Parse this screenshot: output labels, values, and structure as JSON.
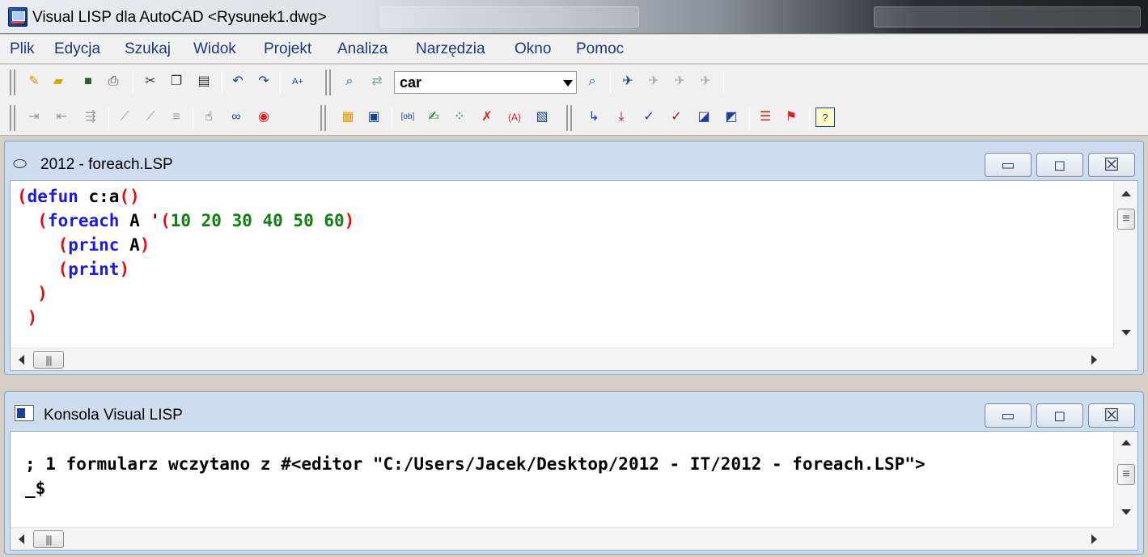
{
  "window": {
    "title": "Visual LISP dla AutoCAD <Rysunek1.dwg>"
  },
  "menu": [
    "Plik",
    "Edycja",
    "Szukaj",
    "Widok",
    "Projekt",
    "Analiza",
    "Narzędzia",
    "Okno",
    "Pomoc"
  ],
  "toolbar": {
    "search_value": "car"
  },
  "icons": {
    "row1": [
      "new-file-icon",
      "open-file-icon",
      "save-icon",
      "print-icon",
      "cut-icon",
      "copy-icon",
      "paste-icon",
      "undo-icon",
      "redo-icon",
      "complete-word-icon",
      "find-icon",
      "replace-icon",
      "find-toolbar-icon",
      "toggle-bookmark-icon",
      "next-bookmark-icon",
      "previous-bookmark-icon",
      "clear-bookmarks-icon"
    ],
    "row2": [
      "indent-block-icon",
      "unindent-block-icon",
      "indent-to-current-icon",
      "comment-block-icon",
      "uncomment-block-icon",
      "format-selection-icon",
      "load-active-window-icon",
      "load-selection-icon",
      "check-edit-icon",
      "activate-autocad-icon",
      "select-window-icon",
      "load-window-icon",
      "inspect-icon",
      "trace-icon",
      "symbol-service-icon",
      "apropos-icon",
      "watch-icon",
      "step-into-icon",
      "step-over-icon",
      "step-out-icon",
      "continue-icon",
      "quit-icon",
      "reset-icon",
      "toggle-breakpoint-icon",
      "add-watch-icon",
      "last-break-icon",
      "help-icon"
    ]
  },
  "editor": {
    "title": "2012 - foreach.LSP",
    "lines": [
      [
        [
          "p",
          "("
        ],
        [
          "k",
          "defun"
        ],
        [
          "s",
          " c:a"
        ],
        [
          "p",
          "()"
        ]
      ],
      [
        [
          "s",
          "  "
        ],
        [
          "p",
          "("
        ],
        [
          "k",
          "foreach"
        ],
        [
          "s",
          " A "
        ],
        [
          "q",
          "'"
        ],
        [
          "p",
          "("
        ],
        [
          "n",
          "10 20 30 40 50 60"
        ],
        [
          "p",
          ")"
        ]
      ],
      [
        [
          "s",
          "    "
        ],
        [
          "p",
          "("
        ],
        [
          "k",
          "princ"
        ],
        [
          "s",
          " A"
        ],
        [
          "p",
          ")"
        ]
      ],
      [
        [
          "s",
          "    "
        ],
        [
          "p",
          "("
        ],
        [
          "k",
          "print"
        ],
        [
          "p",
          ")"
        ]
      ],
      [
        [
          "s",
          "  "
        ],
        [
          "p",
          ")"
        ]
      ],
      [
        [
          "s",
          " "
        ],
        [
          "p",
          ")"
        ]
      ]
    ]
  },
  "console": {
    "title": "Konsola Visual LISP",
    "line1": "; 1 formularz wczytano z #<editor \"C:/Users/Jacek/Desktop/2012 - IT/2012 - foreach.LSP\">",
    "line2": "_$"
  },
  "window_buttons": {
    "minimize": "▭",
    "maximize": "◻",
    "close": "☒"
  }
}
